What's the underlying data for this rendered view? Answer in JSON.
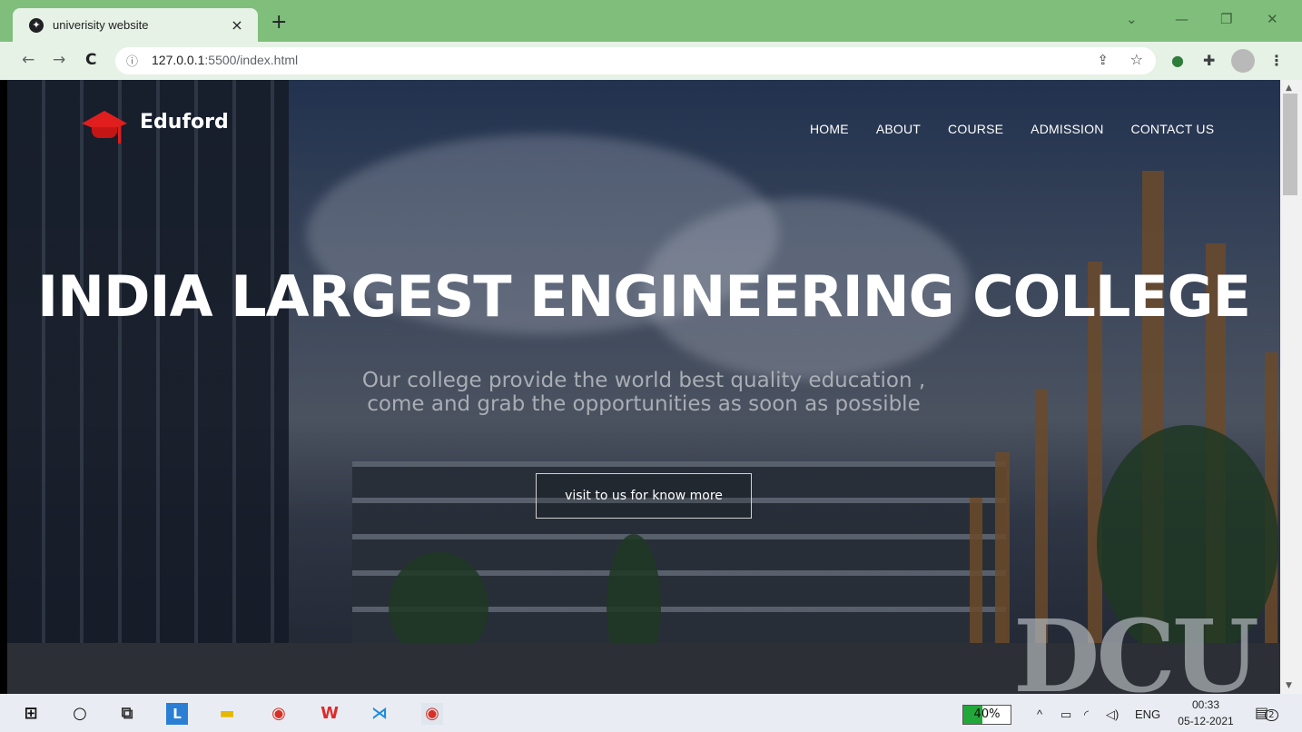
{
  "browser": {
    "tab_title": "univerisity website",
    "tab_close": "×",
    "new_tab": "+",
    "url_host": "127.0.0.1",
    "url_path": ":5500/index.html",
    "window_controls": [
      "⌄",
      "—",
      "❐",
      "✕"
    ],
    "nav_icons": [
      "back-icon",
      "forward-icon",
      "reload-icon"
    ],
    "toolbar_icons": [
      "share-icon",
      "bookmark-star-icon",
      "extension-icon",
      "puzzle-icon",
      "profile-avatar",
      "menu-icon"
    ]
  },
  "site": {
    "brand": "Eduford",
    "nav": [
      "HOME",
      "ABOUT",
      "COURSE",
      "ADMISSION",
      "CONTACT US"
    ],
    "hero_title": "INDIA LARGEST ENGINEERING COLLEGE",
    "hero_sub_line1": "Our college provide the world best quality education ,",
    "hero_sub_line2": "come and grab the opportunities as soon as possible",
    "cta": "visit to us for know more",
    "bg_sign": "DCU"
  },
  "taskbar": {
    "apps": [
      "windows-start-icon",
      "search-icon",
      "task-view-icon",
      "l-app-icon",
      "file-explorer-icon",
      "chrome-icon",
      "wps-icon",
      "vscode-icon",
      "chrome-profile-icon"
    ],
    "battery": "40%",
    "battery_level": 0.4,
    "language": "ENG",
    "time": "00:33",
    "date": "05-12-2021",
    "notifications": "2"
  },
  "colors": {
    "tabbar": "#7fbf7b",
    "toolbar": "#e6f2e5",
    "brand_red": "#e01e1e"
  }
}
